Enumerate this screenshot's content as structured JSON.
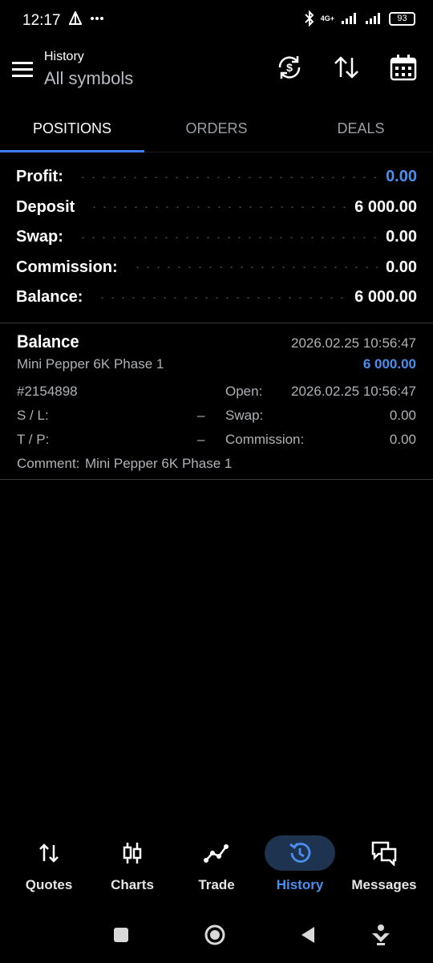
{
  "status_bar": {
    "time": "12:17",
    "network": "4G+",
    "battery": "93"
  },
  "app_bar": {
    "title": "History",
    "subtitle": "All symbols"
  },
  "tabs": [
    {
      "label": "POSITIONS",
      "active": true
    },
    {
      "label": "ORDERS",
      "active": false
    },
    {
      "label": "DEALS",
      "active": false
    }
  ],
  "summary": [
    {
      "label": "Profit:",
      "value": "0.00",
      "value_color": "#4a8ff0"
    },
    {
      "label": "Deposit",
      "value": "6 000.00"
    },
    {
      "label": "Swap:",
      "value": "0.00"
    },
    {
      "label": "Commission:",
      "value": "0.00"
    },
    {
      "label": "Balance:",
      "value": "6 000.00"
    }
  ],
  "deal": {
    "type": "Balance",
    "time": "2026.02.25 10:56:47",
    "account": "Mini Pepper 6K Phase 1",
    "amount": "6 000.00",
    "ticket": "#2154898",
    "open_label": "Open:",
    "open_value": "2026.02.25 10:56:47",
    "sl_label": "S / L:",
    "sl_value": "–",
    "swap_label": "Swap:",
    "swap_value": "0.00",
    "tp_label": "T / P:",
    "tp_value": "–",
    "commission_label": "Commission:",
    "commission_value": "0.00",
    "comment_label": "Comment:",
    "comment_value": "Mini Pepper 6K Phase 1"
  },
  "bottom_nav": [
    {
      "label": "Quotes",
      "icon": "quotes-icon",
      "active": false
    },
    {
      "label": "Charts",
      "icon": "charts-icon",
      "active": false
    },
    {
      "label": "Trade",
      "icon": "trade-icon",
      "active": false
    },
    {
      "label": "History",
      "icon": "history-icon",
      "active": true
    },
    {
      "label": "Messages",
      "icon": "messages-icon",
      "active": false
    }
  ],
  "colors": {
    "accent": "#4a8ff0",
    "tab_indicator": "#3d7eea",
    "active_pill": "#1e3350",
    "background": "#000000"
  }
}
